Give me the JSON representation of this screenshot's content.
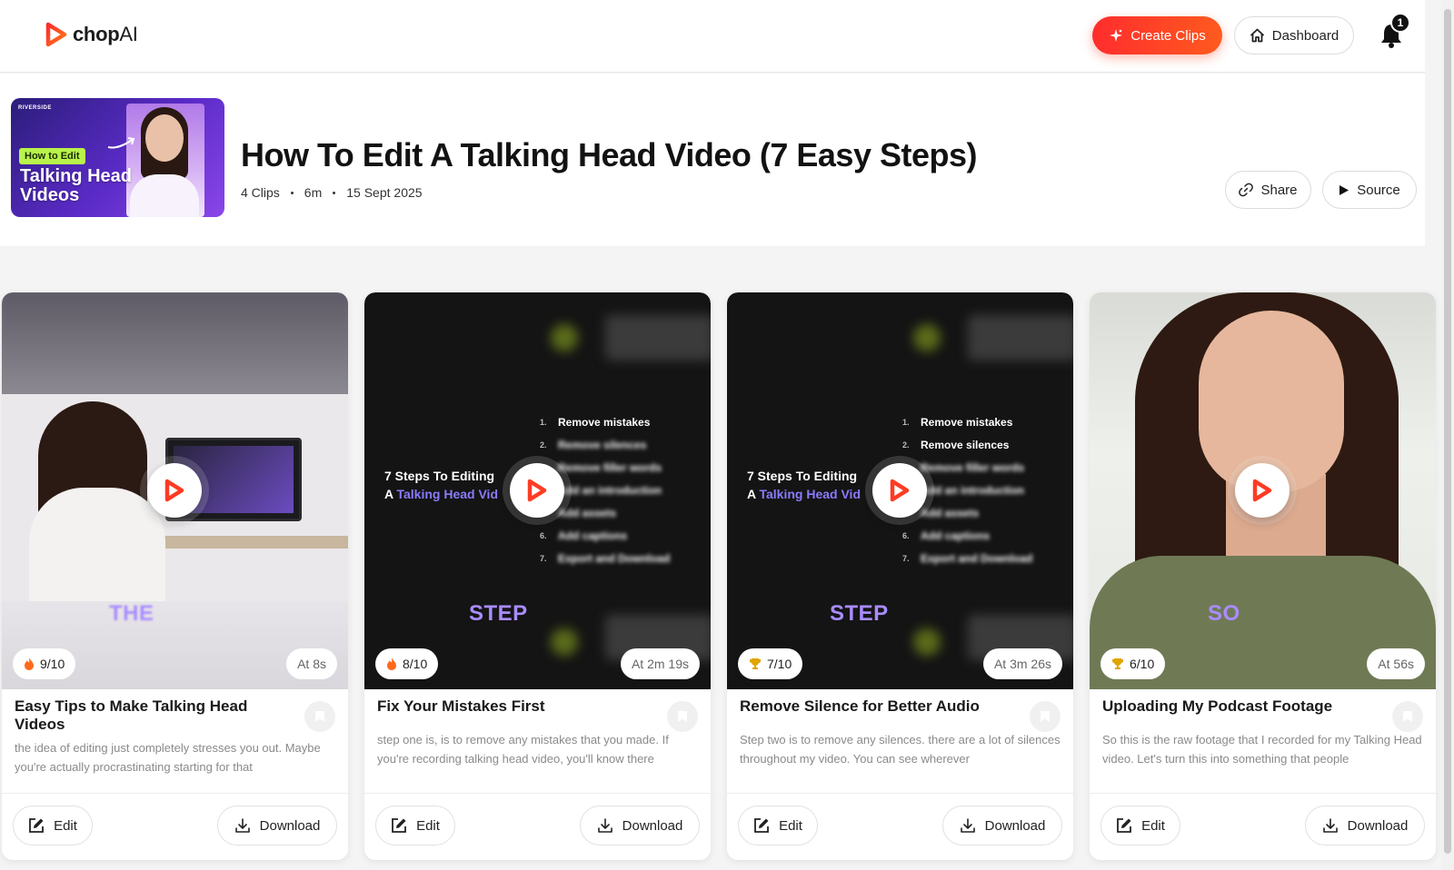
{
  "header": {
    "logo_chop": "chop",
    "logo_ai": "AI",
    "create_label": "Create Clips",
    "dashboard_label": "Dashboard",
    "notification_count": "1"
  },
  "video": {
    "title": "How To Edit A Talking Head Video (7 Easy Steps)",
    "clips": "4 Clips",
    "duration": "6m",
    "date": "15 Sept 2025",
    "thumb_brand": "RIVERSIDE",
    "thumb_tag": "How to Edit",
    "thumb_line1": "Talking Head",
    "thumb_line2": "Videos",
    "share_label": "Share",
    "source_label": "Source"
  },
  "clips": [
    {
      "score": "9/10",
      "score_icon": "fire-icon",
      "at": "At 8s",
      "caption": "THE",
      "title": "Easy Tips to Make Talking Head Videos",
      "description": "the idea of editing just completely stresses you out. Maybe you're actually procrastinating starting for that",
      "edit_label": "Edit",
      "download_label": "Download"
    },
    {
      "score": "8/10",
      "score_icon": "fire-icon",
      "at": "At 2m 19s",
      "caption": "STEP",
      "title": "Fix Your Mistakes First",
      "description": "step one is, is to remove any mistakes that you made. If you're recording talking head video, you'll know there",
      "edit_label": "Edit",
      "download_label": "Download",
      "steps_heading_1": "7 Steps To Editing",
      "steps_heading_2a": "A ",
      "steps_heading_2b": "Talking Head Vid",
      "steps": [
        "Remove mistakes",
        "Remove silences",
        "Remove filler words",
        "Add an introduction",
        "Add assets",
        "Add captions",
        "Export and Download"
      ]
    },
    {
      "score": "7/10",
      "score_icon": "trophy-icon",
      "at": "At 3m 26s",
      "caption": "STEP",
      "title": "Remove Silence for Better Audio",
      "description": "Step two is to remove any silences. there are a lot of silences throughout my video. You can see wherever",
      "edit_label": "Edit",
      "download_label": "Download",
      "steps_heading_1": "7 Steps To Editing",
      "steps_heading_2a": "A ",
      "steps_heading_2b": "Talking Head Vid",
      "steps": [
        "Remove mistakes",
        "Remove silences",
        "Remove filler words",
        "Add an introduction",
        "Add assets",
        "Add captions",
        "Export and Download"
      ]
    },
    {
      "score": "6/10",
      "score_icon": "trophy-icon",
      "at": "At 56s",
      "caption": "SO",
      "title": "Uploading My Podcast Footage",
      "description": "So this is the raw footage that I recorded for my Talking Head video. Let's turn this into something that people",
      "edit_label": "Edit",
      "download_label": "Download"
    }
  ],
  "colors": {
    "accent": "#ff3b24",
    "caption_purple": "#a98cff"
  }
}
